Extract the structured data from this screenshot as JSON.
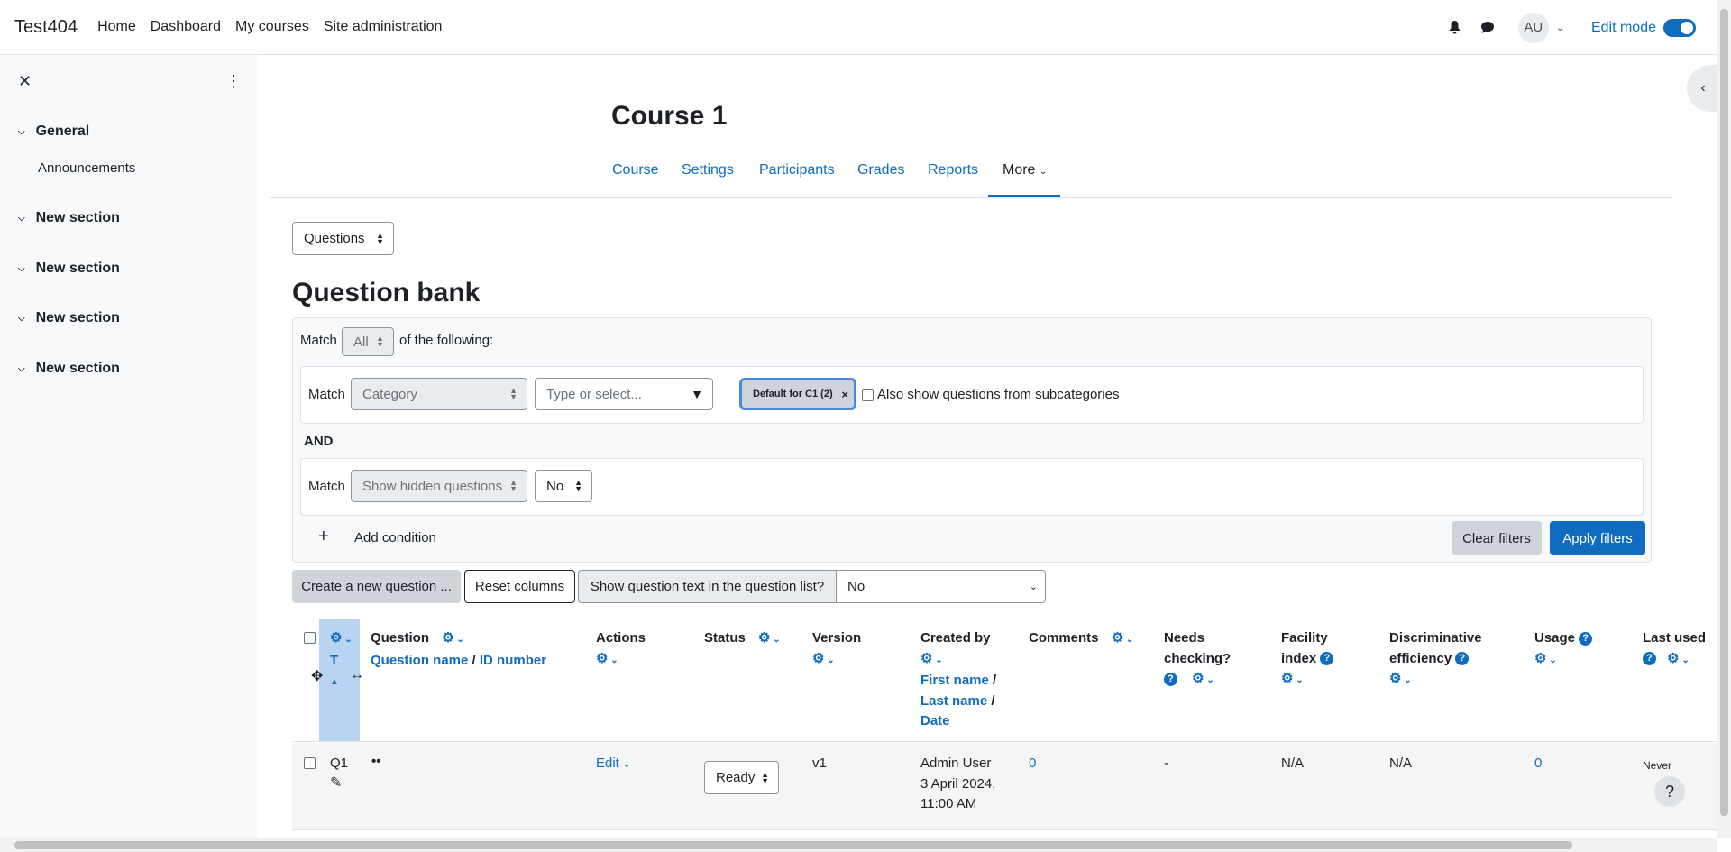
{
  "navbar": {
    "brand": "Test404",
    "links": [
      "Home",
      "Dashboard",
      "My courses",
      "Site administration"
    ],
    "avatar": "AU",
    "edit_mode": "Edit mode",
    "edit_mode_on": true
  },
  "drawer": {
    "sections": [
      {
        "label": "General",
        "items": [
          "Announcements"
        ]
      },
      {
        "label": "New section",
        "items": []
      },
      {
        "label": "New section",
        "items": []
      },
      {
        "label": "New section",
        "items": []
      },
      {
        "label": "New section",
        "items": []
      }
    ]
  },
  "course": {
    "title": "Course 1",
    "tabs": [
      "Course",
      "Settings",
      "Participants",
      "Grades",
      "Reports",
      "More"
    ],
    "active_tab": "More"
  },
  "page_select": "Questions",
  "page_title": "Question bank",
  "filters": {
    "match_label": "Match",
    "match_value": "All",
    "of_following": "of the following:",
    "condition1": {
      "match": "Match",
      "field": "Category",
      "search_placeholder": "Type or select...",
      "selected": "Default for C1 (2)",
      "subcat_label": "Also show questions from subcategories"
    },
    "and_label": "AND",
    "condition2": {
      "match": "Match",
      "field": "Show hidden questions",
      "value": "No"
    },
    "add_condition": "Add condition",
    "clear": "Clear filters",
    "apply": "Apply filters"
  },
  "actions": {
    "create": "Create a new question ...",
    "reset": "Reset columns",
    "show_text_label": "Show question text in the question list?",
    "show_text_value": "No"
  },
  "table": {
    "headers": {
      "type_t": "T",
      "question": "Question",
      "question_name": "Question name",
      "id_number": "ID number",
      "actions": "Actions",
      "status": "Status",
      "version": "Version",
      "created_by": "Created by",
      "first_name": "First name",
      "last_name": "Last name",
      "date": "Date",
      "comments": "Comments",
      "needs_checking": "Needs checking?",
      "facility": "Facility index",
      "discriminative": "Discriminative efficiency",
      "usage": "Usage",
      "last_used": "Last used"
    },
    "rows": [
      {
        "name": "Q1",
        "type_icon": "dots-icon",
        "actions": "Edit",
        "status": "Ready",
        "version": "v1",
        "created_by": "Admin User",
        "created_date": "3 April 2024,",
        "created_time": "11:00 AM",
        "comments": "0",
        "needs_checking": "-",
        "facility": "N/A",
        "discriminative": "N/A",
        "usage": "0",
        "last_used": "Never"
      }
    ]
  },
  "colors": {
    "accent": "#0f6cbf",
    "drawer_bg": "#f8f9fa",
    "column_highlight": "#b8d4f0"
  }
}
